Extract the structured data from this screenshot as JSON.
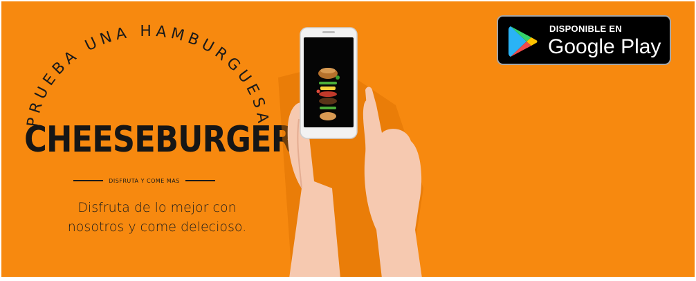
{
  "banner": {
    "arc_text": "PRUEBA UNA HAMBURGUESA",
    "title": "CHEESEBURGER",
    "tagline": "DISFRUTA Y COME MAS",
    "description_line1": "Disfruta de lo mejor con",
    "description_line2": "nosotros y come delecioso.",
    "background_color": "#f7890f"
  },
  "store_badge": {
    "small_label": "DISPONIBLE EN",
    "big_label": "Google Play",
    "icon": "google-play-icon"
  },
  "phone": {
    "icon": "smartphone-icon",
    "screen_image": "floating-burger-illustration"
  }
}
